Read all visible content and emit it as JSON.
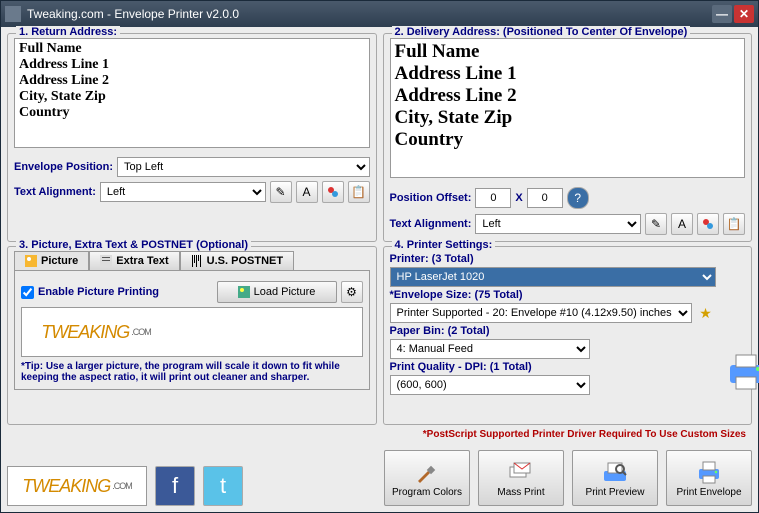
{
  "window": {
    "title": "Tweaking.com - Envelope Printer v2.0.0"
  },
  "return": {
    "title": "1. Return Address:",
    "text": "Full Name\nAddress Line 1\nAddress Line 2\nCity, State Zip\nCountry",
    "pos_label": "Envelope Position:",
    "pos_value": "Top Left",
    "align_label": "Text Alignment:",
    "align_value": "Left"
  },
  "delivery": {
    "title": "2. Delivery Address: (Positioned To Center Of Envelope)",
    "text": "Full Name\nAddress Line 1\nAddress Line 2\nCity, State Zip\nCountry",
    "offset_label": "Position Offset:",
    "off_x": "0",
    "x": "X",
    "off_y": "0",
    "align_label": "Text Alignment:",
    "align_value": "Left"
  },
  "pic": {
    "title": "3. Picture, Extra Text & POSTNET (Optional)",
    "tabs": {
      "picture": "Picture",
      "extra": "Extra Text",
      "postnet": "U.S. POSTNET"
    },
    "enable": "Enable Picture Printing",
    "load": "Load Picture",
    "tip": "*Tip: Use a larger picture, the program will scale it down to fit while keeping the aspect ratio, it will print out cleaner and sharper."
  },
  "printer": {
    "title": "4. Printer Settings:",
    "printer_label": "Printer: (3 Total)",
    "printer_value": "HP LaserJet 1020",
    "env_label": "*Envelope Size: (75 Total)",
    "env_value": "Printer Supported - 20: Envelope #10 (4.12x9.50) inches",
    "bin_label": "Paper Bin: (2 Total)",
    "bin_value": "4: Manual Feed",
    "dpi_label": "Print Quality - DPI: (1 Total)",
    "dpi_value": "(600, 600)"
  },
  "footer": {
    "ps_note": "*PostScript Supported Printer Driver Required To Use Custom Sizes",
    "colors": "Program Colors",
    "mass": "Mass Print",
    "preview": "Print Preview",
    "print": "Print Envelope"
  },
  "brand": {
    "name": "TWEAKING",
    "suffix": ".COM"
  }
}
